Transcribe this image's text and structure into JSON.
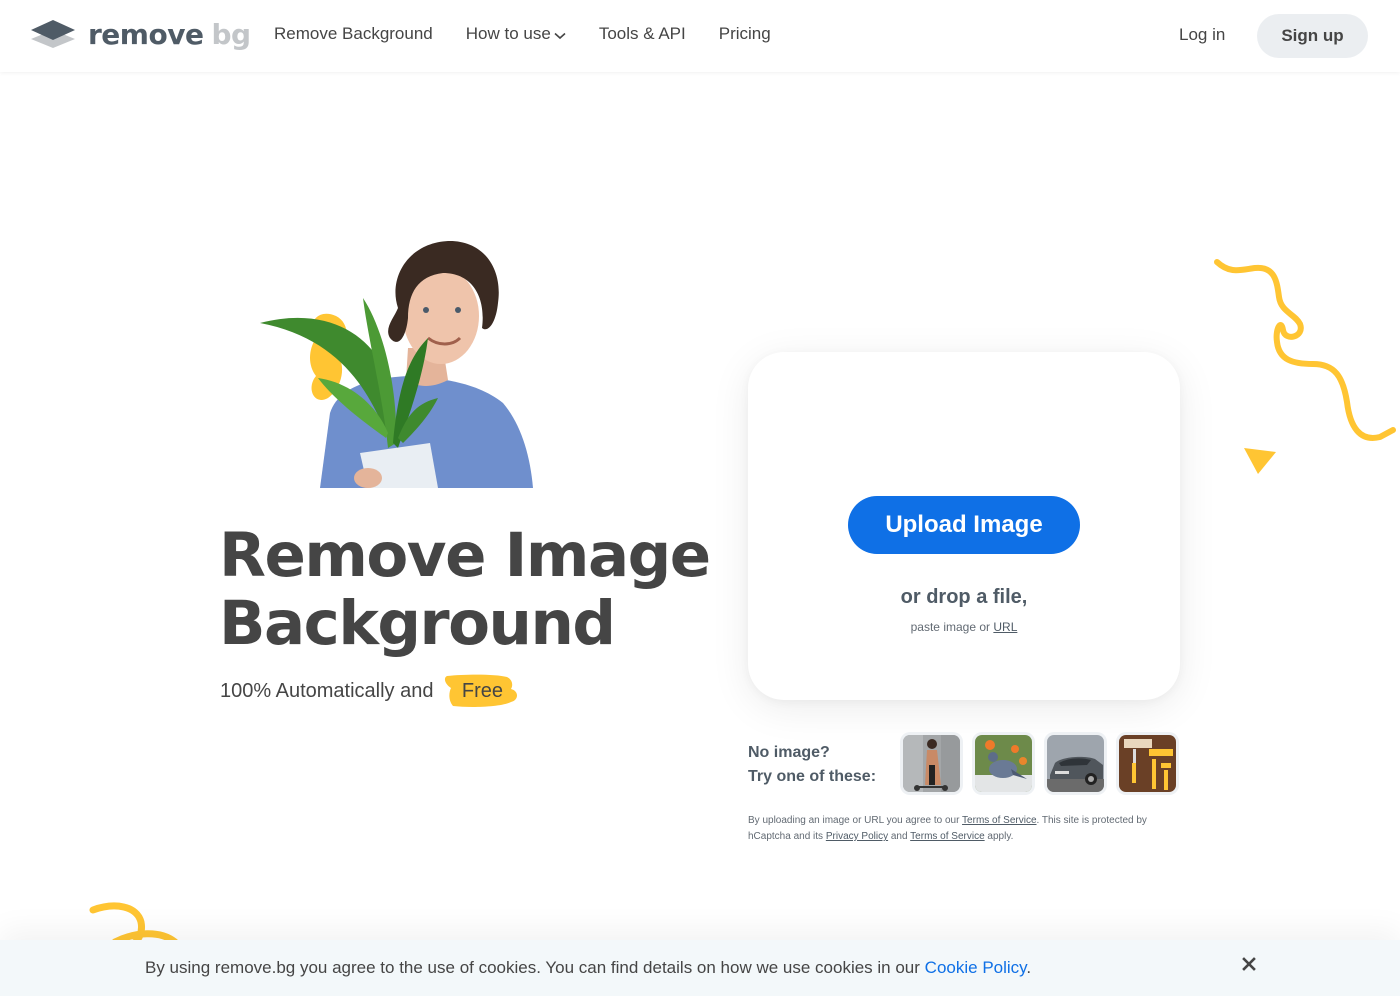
{
  "header": {
    "logo": {
      "icon": "layers-logo-icon",
      "text_primary": "remove",
      "text_secondary": "bg"
    },
    "nav": [
      {
        "label": "Remove Background",
        "has_dropdown": false
      },
      {
        "label": "How to use",
        "has_dropdown": true,
        "dropdown_icon": "chevron-down-icon"
      },
      {
        "label": "Tools & API",
        "has_dropdown": false
      },
      {
        "label": "Pricing",
        "has_dropdown": false
      }
    ],
    "login_label": "Log in",
    "signup_label": "Sign up"
  },
  "hero": {
    "photo_alt": "Man in blue t-shirt holding a potted plant",
    "headline_line1": "Remove Image",
    "headline_line2": "Background",
    "subline_prefix": "100% Automatically and",
    "subline_highlight": "Free"
  },
  "upload": {
    "button_label": "Upload Image",
    "drop_text": "or drop a file,",
    "paste_prefix": "paste image or",
    "paste_link": "URL"
  },
  "samples": {
    "label_line1": "No image?",
    "label_line2": "Try one of these:",
    "items": [
      {
        "name": "woman-with-scooter"
      },
      {
        "name": "pigeons"
      },
      {
        "name": "grey-car"
      },
      {
        "name": "paint-rollers"
      }
    ]
  },
  "legal": {
    "part1": "By uploading an image or URL you agree to our",
    "link1": "Terms of Service",
    "part2": ". This site is protected by hCaptcha and its",
    "link2": "Privacy Policy",
    "part3": "and",
    "link3": "Terms of Service",
    "part4": "apply."
  },
  "cookie_bar": {
    "text": "By using remove.bg you agree to the use of cookies. You can find details on how we use cookies in our",
    "link": "Cookie Policy",
    "suffix": ".",
    "close_icon": "close-icon"
  },
  "colors": {
    "accent_blue": "#0f70e6",
    "brand_yellow": "#ffc533",
    "text_dark": "#454545",
    "logo_slate": "#4f5b66",
    "cookie_bg": "#f3f8fa"
  }
}
